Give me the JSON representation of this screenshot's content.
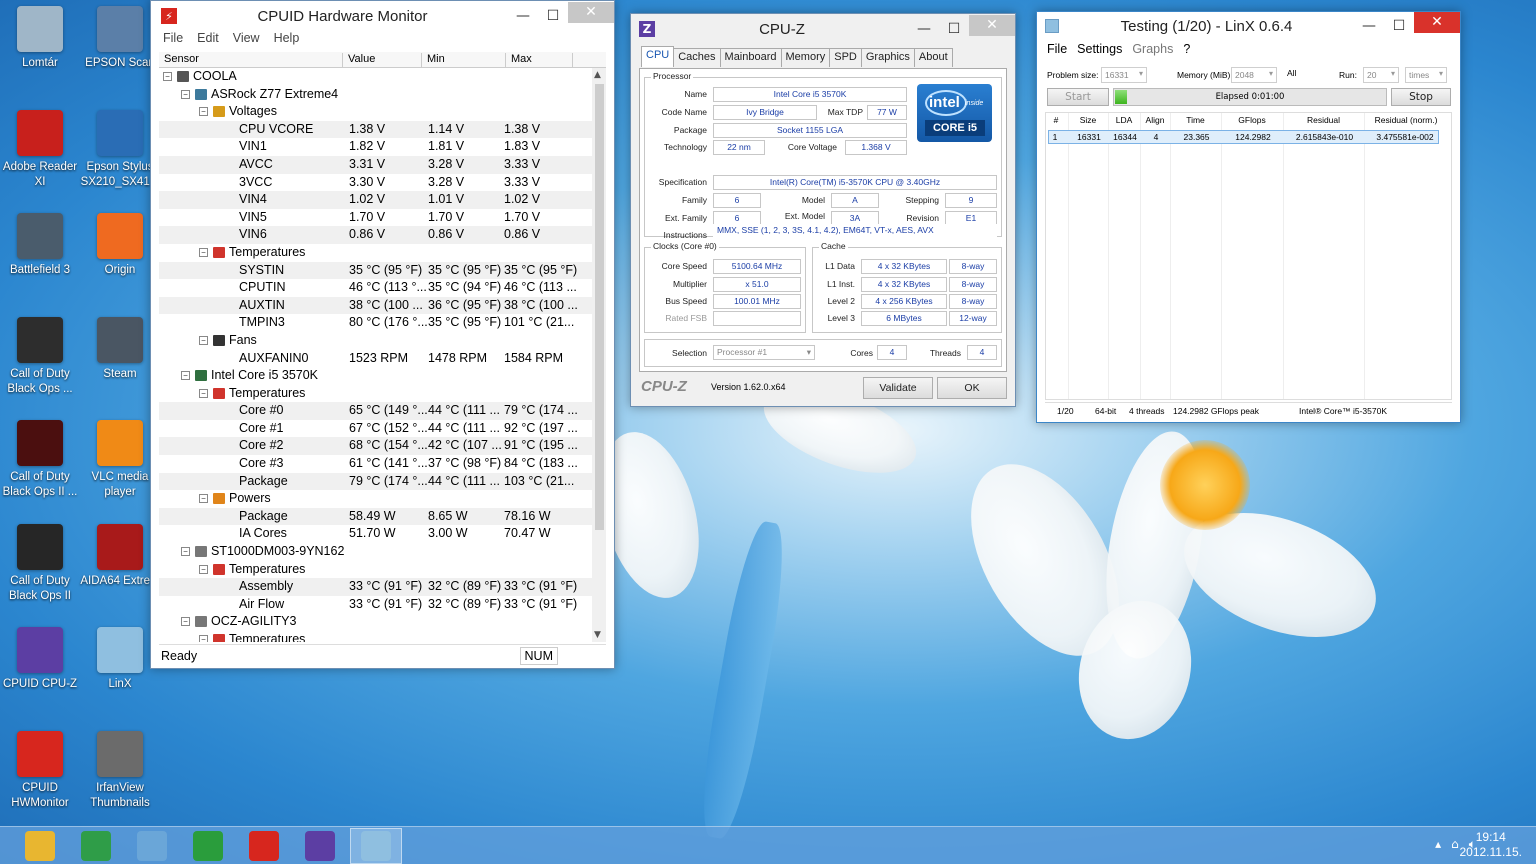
{
  "desktop": {
    "icons": [
      {
        "label": "Lomtár",
        "color": "#9fb6c8"
      },
      {
        "label": "EPSON Scan",
        "color": "#5b7fa8"
      },
      {
        "label": "Adobe Reader XI",
        "color": "#c8201c"
      },
      {
        "label": "Epson Stylus SX210_SX41...",
        "color": "#2a6db5"
      },
      {
        "label": "Battlefield 3",
        "color": "#4a5c6c"
      },
      {
        "label": "Origin",
        "color": "#ef6a20"
      },
      {
        "label": "Call of Duty Black Ops ...",
        "color": "#2d2d2d"
      },
      {
        "label": "Steam",
        "color": "#4a5663"
      },
      {
        "label": "Call of Duty Black Ops II ...",
        "color": "#4b0f0f"
      },
      {
        "label": "VLC media player",
        "color": "#f08a16"
      },
      {
        "label": "Call of Duty Black Ops II",
        "color": "#262626"
      },
      {
        "label": "AIDA64 Extre...",
        "color": "#a81a1a"
      },
      {
        "label": "CPUID CPU-Z",
        "color": "#5c3ea3"
      },
      {
        "label": "LinX",
        "color": "#8fbfe0"
      },
      {
        "label": "CPUID HWMonitor",
        "color": "#d7261e"
      },
      {
        "label": "IrfanView Thumbnails",
        "color": "#6b6b6b"
      }
    ]
  },
  "hwmonitor": {
    "title": "CPUID Hardware Monitor",
    "menu": [
      "File",
      "Edit",
      "View",
      "Help"
    ],
    "columns": [
      "Sensor",
      "Value",
      "Min",
      "Max"
    ],
    "rows": [
      {
        "level": 0,
        "label": "COOLA",
        "icon": "computer-icon",
        "exp": "−"
      },
      {
        "level": 1,
        "label": "ASRock Z77 Extreme4",
        "icon": "motherboard-icon",
        "exp": "−"
      },
      {
        "level": 2,
        "label": "Voltages",
        "icon": "voltage-icon",
        "exp": "−"
      },
      {
        "level": 3,
        "label": "CPU VCORE",
        "v": "1.38 V",
        "min": "1.14 V",
        "max": "1.38 V"
      },
      {
        "level": 3,
        "label": "VIN1",
        "v": "1.82 V",
        "min": "1.81 V",
        "max": "1.83 V"
      },
      {
        "level": 3,
        "label": "AVCC",
        "v": "3.31 V",
        "min": "3.28 V",
        "max": "3.33 V"
      },
      {
        "level": 3,
        "label": "3VCC",
        "v": "3.30 V",
        "min": "3.28 V",
        "max": "3.33 V"
      },
      {
        "level": 3,
        "label": "VIN4",
        "v": "1.02 V",
        "min": "1.01 V",
        "max": "1.02 V"
      },
      {
        "level": 3,
        "label": "VIN5",
        "v": "1.70 V",
        "min": "1.70 V",
        "max": "1.70 V"
      },
      {
        "level": 3,
        "label": "VIN6",
        "v": "0.86 V",
        "min": "0.86 V",
        "max": "0.86 V"
      },
      {
        "level": 2,
        "label": "Temperatures",
        "icon": "thermometer-icon",
        "exp": "−"
      },
      {
        "level": 3,
        "label": "SYSTIN",
        "v": "35 °C  (95 °F)",
        "min": "35 °C  (95 °F)",
        "max": "35 °C  (95 °F)"
      },
      {
        "level": 3,
        "label": "CPUTIN",
        "v": "46 °C  (113 °...",
        "min": "35 °C  (94 °F)",
        "max": "46 °C  (113 ..."
      },
      {
        "level": 3,
        "label": "AUXTIN",
        "v": "38 °C  (100 ...",
        "min": "36 °C  (95 °F)",
        "max": "38 °C  (100 ..."
      },
      {
        "level": 3,
        "label": "TMPIN3",
        "v": "80 °C  (176 °...",
        "min": "35 °C  (95 °F)",
        "max": "101 °C  (21..."
      },
      {
        "level": 2,
        "label": "Fans",
        "icon": "fan-icon",
        "exp": "−"
      },
      {
        "level": 3,
        "label": "AUXFANIN0",
        "v": "1523 RPM",
        "min": "1478 RPM",
        "max": "1584 RPM"
      },
      {
        "level": 1,
        "label": "Intel Core i5 3570K",
        "icon": "cpu-icon",
        "exp": "−"
      },
      {
        "level": 2,
        "label": "Temperatures",
        "icon": "thermometer-icon",
        "exp": "−"
      },
      {
        "level": 3,
        "label": "Core #0",
        "v": "65 °C  (149 °...",
        "min": "44 °C  (111 ...",
        "max": "79 °C  (174 ..."
      },
      {
        "level": 3,
        "label": "Core #1",
        "v": "67 °C  (152 °...",
        "min": "44 °C  (111 ...",
        "max": "92 °C  (197 ..."
      },
      {
        "level": 3,
        "label": "Core #2",
        "v": "68 °C  (154 °...",
        "min": "42 °C  (107 ...",
        "max": "91 °C  (195 ..."
      },
      {
        "level": 3,
        "label": "Core #3",
        "v": "61 °C  (141 °...",
        "min": "37 °C  (98 °F)",
        "max": "84 °C  (183 ..."
      },
      {
        "level": 3,
        "label": "Package",
        "v": "79 °C  (174 °...",
        "min": "44 °C  (111 ...",
        "max": "103 °C  (21..."
      },
      {
        "level": 2,
        "label": "Powers",
        "icon": "power-icon",
        "exp": "−"
      },
      {
        "level": 3,
        "label": "Package",
        "v": "58.49 W",
        "min": "8.65 W",
        "max": "78.16 W"
      },
      {
        "level": 3,
        "label": "IA Cores",
        "v": "51.70 W",
        "min": "3.00 W",
        "max": "70.47 W"
      },
      {
        "level": 1,
        "label": "ST1000DM003-9YN162",
        "icon": "disk-icon",
        "exp": "−"
      },
      {
        "level": 2,
        "label": "Temperatures",
        "icon": "thermometer-icon",
        "exp": "−"
      },
      {
        "level": 3,
        "label": "Assembly",
        "v": "33 °C  (91 °F)",
        "min": "32 °C  (89 °F)",
        "max": "33 °C  (91 °F)"
      },
      {
        "level": 3,
        "label": "Air Flow",
        "v": "33 °C  (91 °F)",
        "min": "32 °C  (89 °F)",
        "max": "33 °C  (91 °F)"
      },
      {
        "level": 1,
        "label": "OCZ-AGILITY3",
        "icon": "disk-icon",
        "exp": "−"
      },
      {
        "level": 2,
        "label": "Temperatures",
        "icon": "thermometer-icon",
        "exp": "−"
      }
    ],
    "status": "Ready",
    "num": "NUM"
  },
  "cpuz": {
    "title": "CPU-Z",
    "tabs": [
      "CPU",
      "Caches",
      "Mainboard",
      "Memory",
      "SPD",
      "Graphics",
      "About"
    ],
    "processor_label": "Processor",
    "name_k": "Name",
    "name_v": "Intel Core i5 3570K",
    "codename_k": "Code Name",
    "codename_v": "Ivy Bridge",
    "maxtdp_k": "Max TDP",
    "maxtdp_v": "77 W",
    "package_k": "Package",
    "package_v": "Socket 1155 LGA",
    "tech_k": "Technology",
    "tech_v": "22 nm",
    "corev_k": "Core Voltage",
    "corev_v": "1.368 V",
    "spec_k": "Specification",
    "spec_v": "Intel(R) Core(TM) i5-3570K CPU @ 3.40GHz",
    "family_k": "Family",
    "family_v": "6",
    "model_k": "Model",
    "model_v": "A",
    "stepping_k": "Stepping",
    "stepping_v": "9",
    "extfamily_k": "Ext. Family",
    "extfamily_v": "6",
    "extmodel_k": "Ext. Model",
    "extmodel_v": "3A",
    "revision_k": "Revision",
    "revision_v": "E1",
    "instr_k": "Instructions",
    "instr_v": "MMX, SSE (1, 2, 3, 3S, 4.1, 4.2), EM64T, VT-x, AES, AVX",
    "clocks_label": "Clocks (Core #0)",
    "corespeed_k": "Core Speed",
    "corespeed_v": "5100.64 MHz",
    "mult_k": "Multiplier",
    "mult_v": "x 51.0",
    "bus_k": "Bus Speed",
    "bus_v": "100.01 MHz",
    "fsb_k": "Rated FSB",
    "fsb_v": "",
    "cache_label": "Cache",
    "l1d_k": "L1 Data",
    "l1d_v": "4 x 32 KBytes",
    "l1d_w": "8-way",
    "l1i_k": "L1 Inst.",
    "l1i_v": "4 x 32 KBytes",
    "l1i_w": "8-way",
    "l2_k": "Level 2",
    "l2_v": "4 x 256 KBytes",
    "l2_w": "8-way",
    "l3_k": "Level 3",
    "l3_v": "6 MBytes",
    "l3_w": "12-way",
    "sel_k": "Selection",
    "sel_v": "Processor #1",
    "cores_k": "Cores",
    "cores_v": "4",
    "threads_k": "Threads",
    "threads_v": "4",
    "brand": "CPU-Z",
    "version": "Version 1.62.0.x64",
    "validate": "Validate",
    "ok": "OK",
    "intel_word": "intel",
    "intel_inside": "inside",
    "intel_core": "CORE i5"
  },
  "linx": {
    "title": "Testing (1/20) - LinX 0.6.4",
    "menu": [
      "File",
      "Settings",
      "Graphs",
      "?"
    ],
    "problem_k": "Problem size:",
    "problem_v": "16331",
    "memory_k": "Memory (MiB):",
    "memory_v": "2048",
    "all": "All",
    "run_k": "Run:",
    "run_v": "20",
    "times": "times",
    "start": "Start",
    "elapsed": "Elapsed 0:01:00",
    "progress": 0.05,
    "stop": "Stop",
    "headers": [
      "#",
      "Size",
      "LDA",
      "Align",
      "Time",
      "GFlops",
      "Residual",
      "Residual (norm.)"
    ],
    "row": [
      "1",
      "16331",
      "16344",
      "4",
      "23.365",
      "124.2982",
      "2.615843e-010",
      "3.475581e-002"
    ],
    "status": [
      "1/20",
      "64-bit",
      "4 threads",
      "124.2982 GFlops peak",
      "Intel® Core™ i5-3570K"
    ]
  },
  "taskbar": {
    "items": [
      {
        "name": "explorer-icon",
        "color": "#e8b630"
      },
      {
        "name": "chrome-icon",
        "color": "#2f9d48"
      },
      {
        "name": "paint-icon",
        "color": "#6aa6d8"
      },
      {
        "name": "utorrent-icon",
        "color": "#2a9d3c"
      },
      {
        "name": "hwmonitor-icon",
        "color": "#d7261e"
      },
      {
        "name": "cpuz-icon",
        "color": "#5c3ea3"
      },
      {
        "name": "linx-icon",
        "color": "#8fbfe0"
      }
    ],
    "time": "19:14",
    "date": "2012.11.15."
  }
}
